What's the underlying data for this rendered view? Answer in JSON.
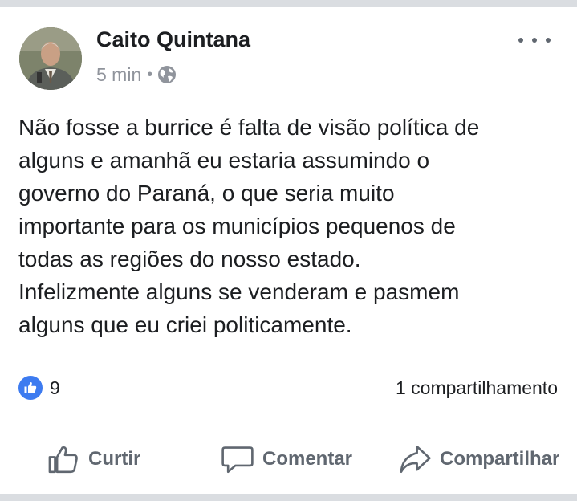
{
  "post": {
    "author": "Caito Quintana",
    "time": "5 min",
    "separator": "•",
    "privacy_icon": "globe-icon",
    "text_lines": [
      "Não fosse a burrice é falta de visão política de",
      "alguns e amanhã eu estaria assumindo o",
      "governo do Paraná, o que seria muito",
      "importante para os municípios pequenos de",
      "todas as regiões do nosso estado.",
      "Infelizmente alguns se venderam e pasmem",
      "alguns que eu criei politicamente."
    ]
  },
  "reactions": {
    "like_count": "9",
    "shares": "1 compartilhamento"
  },
  "actions": {
    "like": "Curtir",
    "comment": "Comentar",
    "share": "Compartilhar"
  },
  "colors": {
    "like_blue": "#3d7bf0",
    "secondary_text": "#90949c",
    "action_gray": "#606770"
  }
}
